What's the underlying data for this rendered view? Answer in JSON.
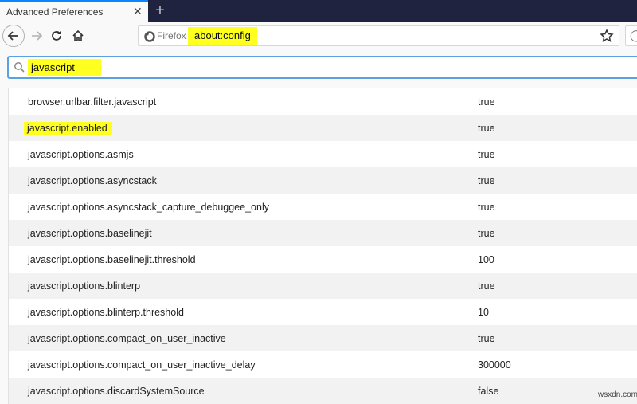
{
  "tab": {
    "title": "Advanced Preferences",
    "close_icon": "close-icon",
    "new_tab_label": "+"
  },
  "navbar": {
    "back_icon": "arrow-left-icon",
    "forward_icon": "arrow-right-icon",
    "reload_icon": "reload-icon",
    "home_icon": "home-icon",
    "identity_label": "Firefox",
    "url": "about:config",
    "bookmark_icon": "star-icon"
  },
  "filter": {
    "value": "javascript",
    "icon": "search-icon"
  },
  "prefs": [
    {
      "name": "browser.urlbar.filter.javascript",
      "value": "true"
    },
    {
      "name": "javascript.enabled",
      "value": "true",
      "highlighted": true
    },
    {
      "name": "javascript.options.asmjs",
      "value": "true"
    },
    {
      "name": "javascript.options.asyncstack",
      "value": "true"
    },
    {
      "name": "javascript.options.asyncstack_capture_debuggee_only",
      "value": "true"
    },
    {
      "name": "javascript.options.baselinejit",
      "value": "true"
    },
    {
      "name": "javascript.options.baselinejit.threshold",
      "value": "100"
    },
    {
      "name": "javascript.options.blinterp",
      "value": "true"
    },
    {
      "name": "javascript.options.blinterp.threshold",
      "value": "10"
    },
    {
      "name": "javascript.options.compact_on_user_inactive",
      "value": "true"
    },
    {
      "name": "javascript.options.compact_on_user_inactive_delay",
      "value": "300000"
    },
    {
      "name": "javascript.options.discardSystemSource",
      "value": "false"
    }
  ],
  "watermark": "wsxdn.com",
  "colors": {
    "highlight": "#ffff20",
    "tabstrip": "#1f2340",
    "focus_ring": "#5ba0e3"
  }
}
